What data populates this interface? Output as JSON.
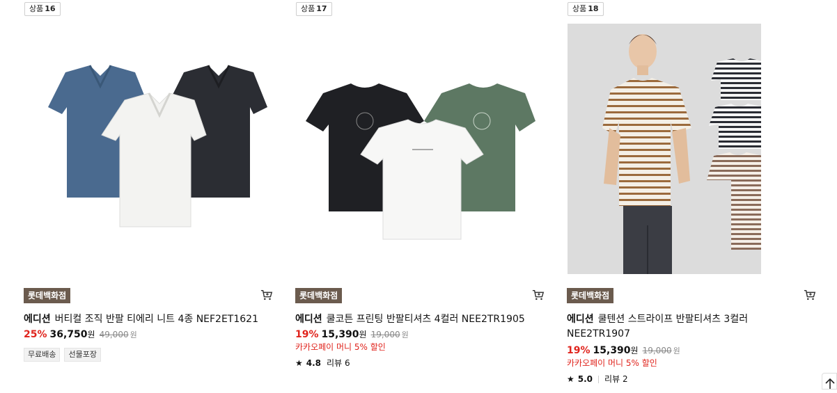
{
  "products": [
    {
      "badge_prefix": "상품",
      "badge_number": "16",
      "store": "롯데백화점",
      "brand": "에디션",
      "name": "버티컬 조직 반팔 티에리 니트 4종 NEF2ET1621",
      "discount": "25%",
      "price": "36,750",
      "price_unit": "원",
      "original_price": "49,000",
      "original_unit": "원",
      "tags": [
        "무료배송",
        "선물포장"
      ]
    },
    {
      "badge_prefix": "상품",
      "badge_number": "17",
      "store": "롯데백화점",
      "brand": "에디션",
      "name": "쿨코튼 프린팅 반팔티셔츠 4컬러 NEE2TR1905",
      "discount": "19%",
      "price": "15,390",
      "price_unit": "원",
      "original_price": "19,000",
      "original_unit": "원",
      "promo": "카카오페이 머니 5% 할인",
      "rating": "4.8",
      "review_label": "리뷰",
      "review_count": "6"
    },
    {
      "badge_prefix": "상품",
      "badge_number": "18",
      "store": "롯데백화점",
      "brand": "에디션",
      "name": "쿨텐션 스트라이프 반팔티셔츠 3컬러 NEE2TR1907",
      "discount": "19%",
      "price": "15,390",
      "price_unit": "원",
      "original_price": "19,000",
      "original_unit": "원",
      "promo": "카카오페이 머니 5% 할인",
      "rating": "5.0",
      "review_label": "리뷰",
      "review_count": "2"
    }
  ],
  "colors": {
    "store_badge_bg": "#6b5b4e",
    "discount_red": "#e0241d"
  },
  "icons": {
    "cart": "cart-icon",
    "star": "star-icon",
    "scroll_top": "arrow-up-icon"
  }
}
